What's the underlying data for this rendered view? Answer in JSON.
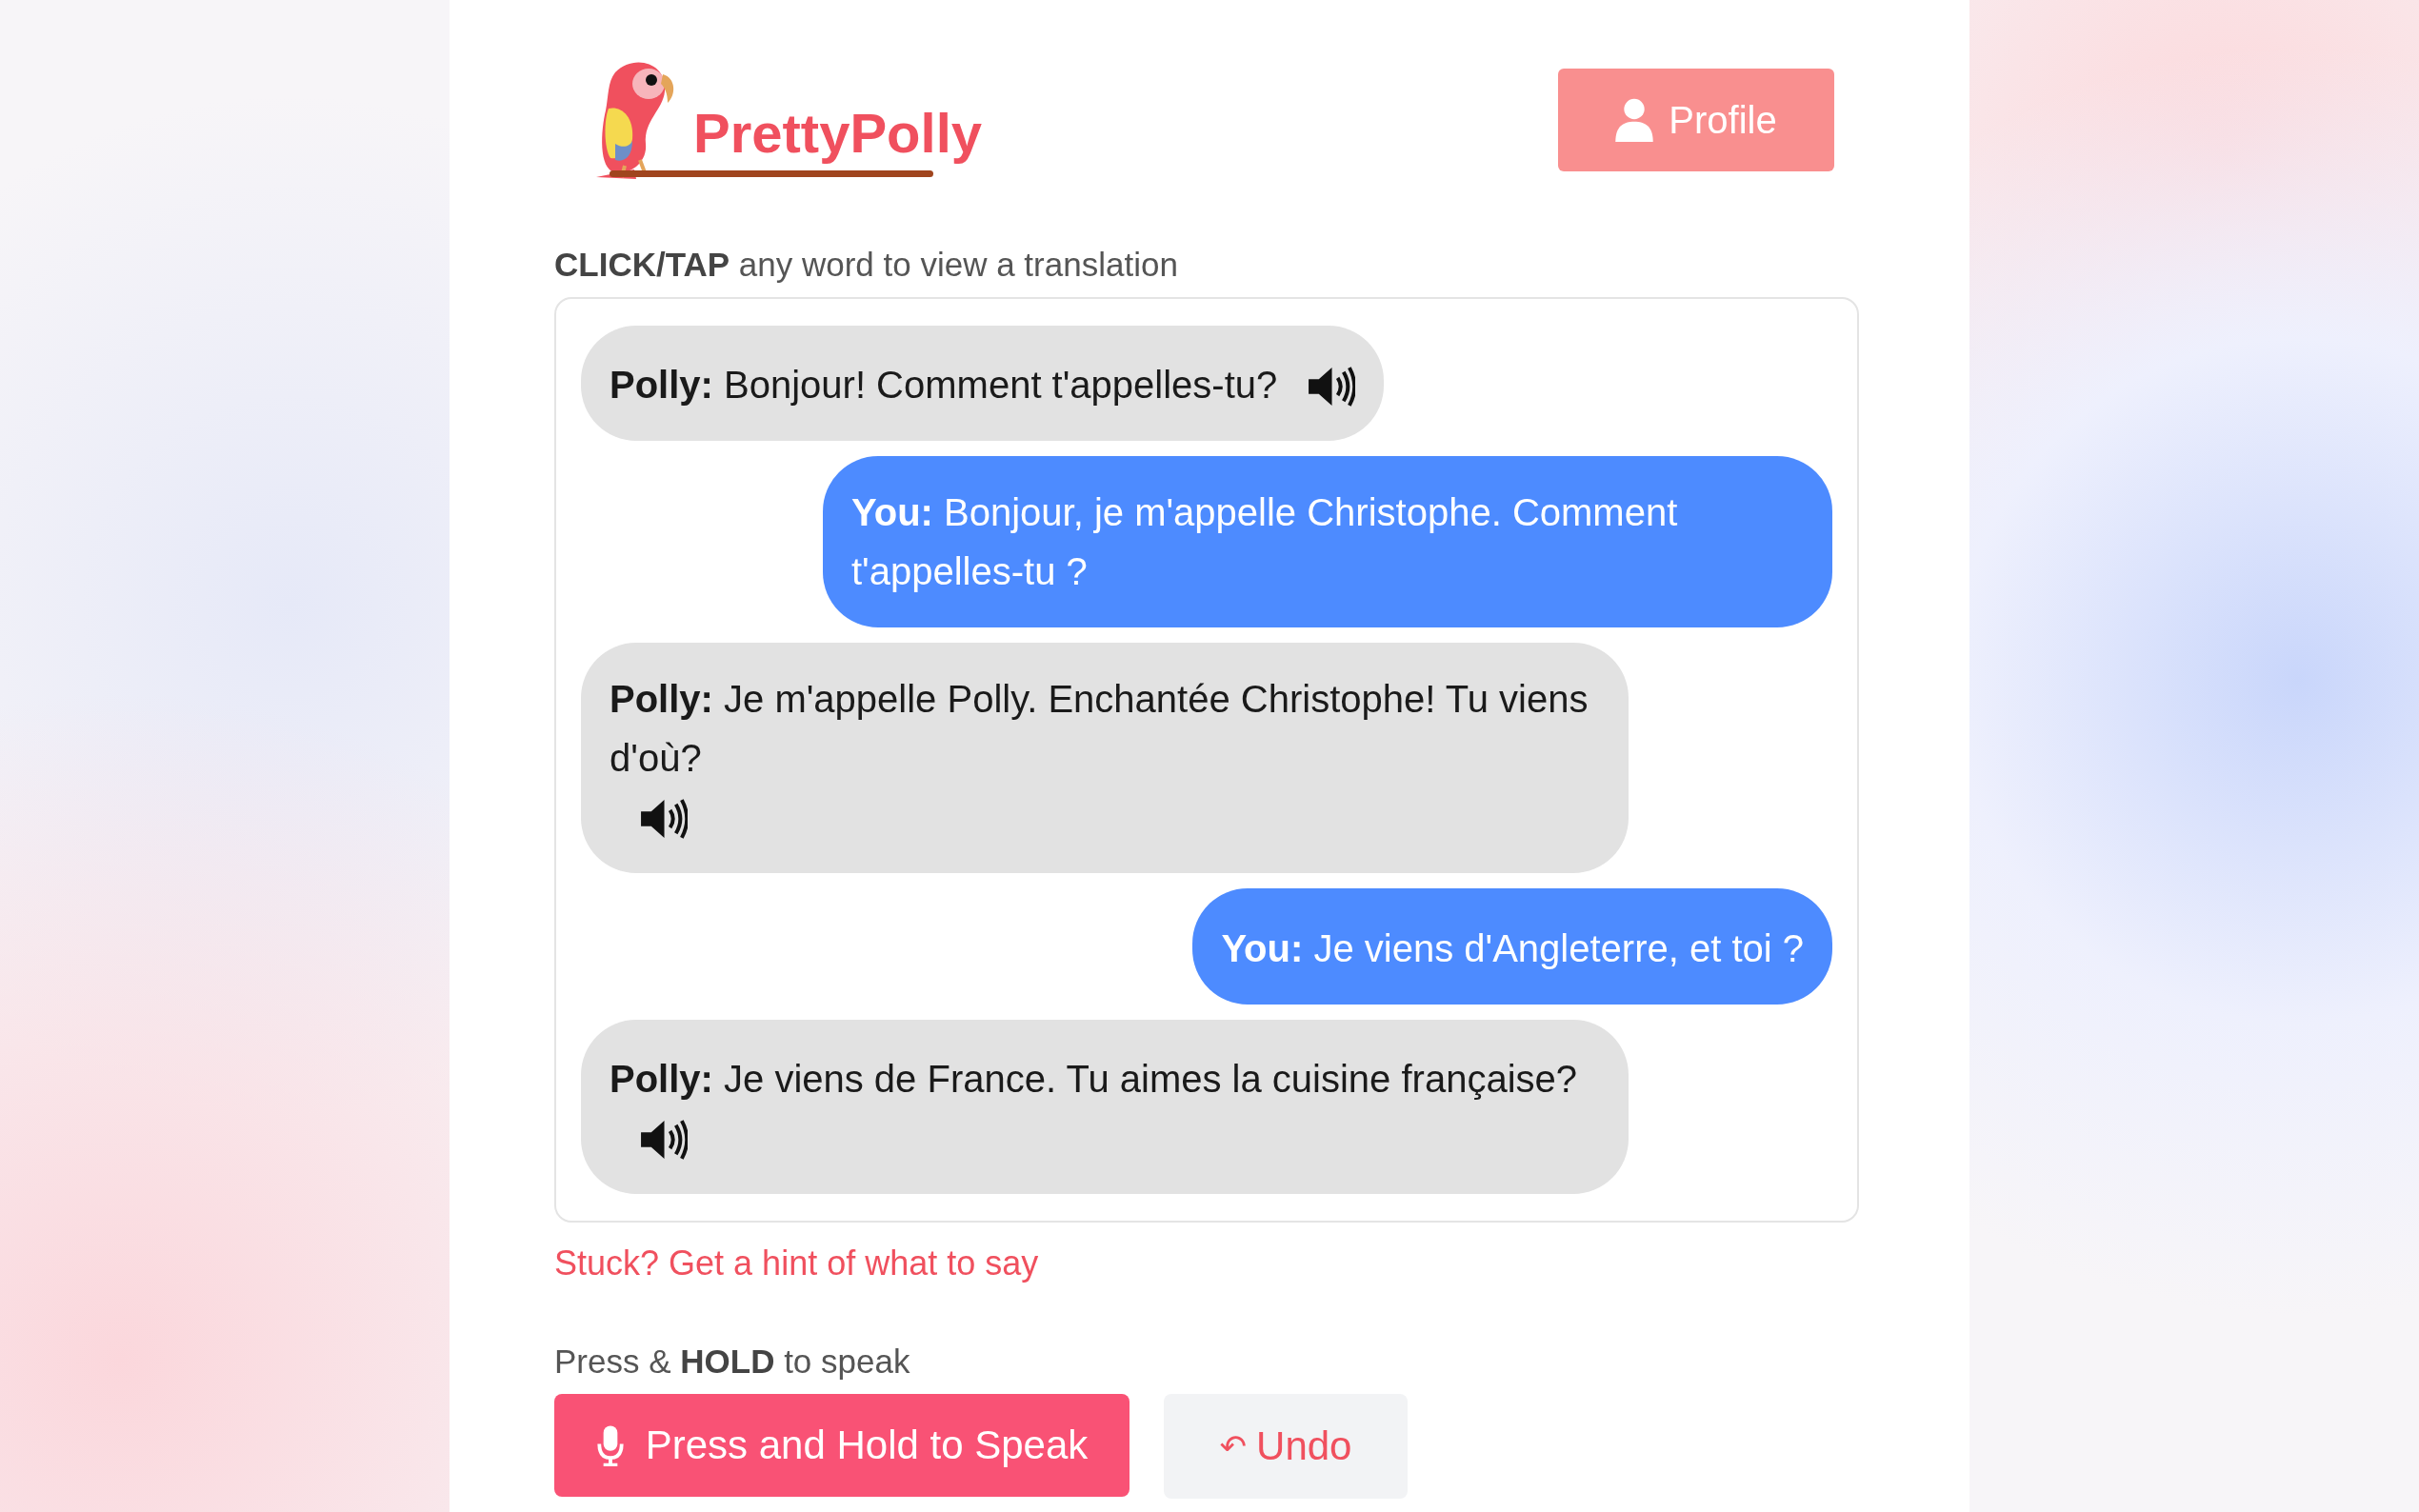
{
  "brand": {
    "name": "PrettyPolly"
  },
  "profile_button": {
    "label": "Profile"
  },
  "instruction": "**CLICK/TAP** any word to view a translation",
  "messages": [
    {
      "kind": "polly",
      "text": "**Polly:** Bonjour! Comment t'appelles-tu?"
    },
    {
      "kind": "user",
      "text": "**You:** Bonjour, je m'appelle Christophe. Comment t'appelles-tu ?"
    },
    {
      "kind": "polly",
      "text": "**Polly:** Je m'appelle Polly. Enchantée Christophe! Tu viens d'où?"
    },
    {
      "kind": "user",
      "text": "**You:** Je viens d'Angleterre, et toi ?"
    },
    {
      "kind": "polly",
      "text": "**Polly:** Je viens de France. Tu aimes la cuisine française?"
    }
  ],
  "hint_link": "Stuck? Get a hint of what to say",
  "speak_label": "Press & **HOLD** to speak",
  "speak_button": {
    "label": "Press and Hold to Speak"
  },
  "undo_button": {
    "icon": "↶",
    "label": "Undo"
  }
}
